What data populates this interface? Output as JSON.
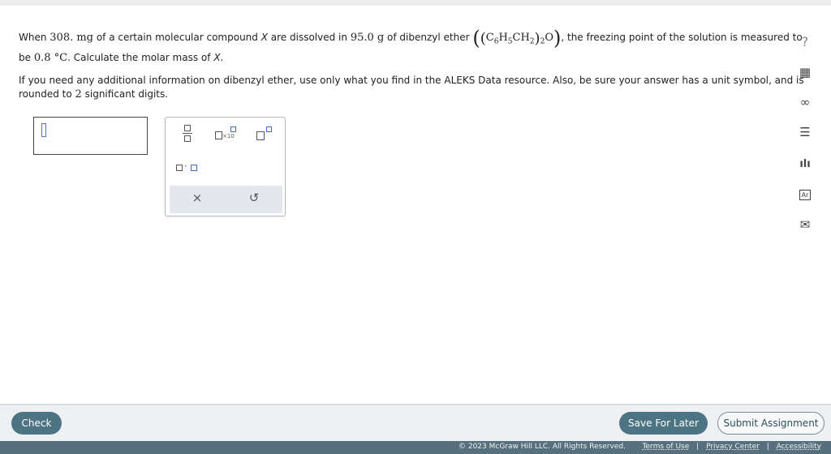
{
  "question": {
    "l1_a": "When ",
    "mass": "308. mg",
    "l1_b": " of a certain molecular compound ",
    "compound": "X",
    "l1_c": " are dissolved in ",
    "solvent_mass": "95.0 g",
    "l1_d": " of dibenzyl ether ",
    "formula": {
      "c": "C",
      "c_sub": "6",
      "h": "H",
      "h_sub": "5",
      "ch": "CH",
      "ch_sub": "2",
      "group_sub": "2",
      "o": "O"
    },
    "l1_e": ", the freezing point of the solution is measured to",
    "l2_a": "be ",
    "temp": "0.8 °C",
    "l2_b": ". Calculate the molar mass of ",
    "l2_c": ".",
    "l3": "If you need any additional information on dibenzyl ether, use only what you find in the ALEKS Data resource. Also, be sure your answer has a unit symbol, and is",
    "l4_a": "rounded to ",
    "sig_figs": "2",
    "l4_b": " significant digits."
  },
  "answer": {
    "value": ""
  },
  "palette": {
    "times_symbol": "×10",
    "dot_symbol": "·",
    "clear_symbol": "×",
    "undo_symbol": "↺"
  },
  "sidebar": {
    "help": "?",
    "calculator": "▦",
    "link": "∞",
    "notes": "☰",
    "chart": "ılı",
    "periodic": "Ar",
    "mail": "✉"
  },
  "footer": {
    "check": "Check",
    "save": "Save For Later",
    "submit": "Submit Assignment",
    "copyright": "© 2023 McGraw Hill LLC. All Rights Reserved.",
    "terms": "Terms of Use",
    "privacy": "Privacy Center",
    "accessibility": "Accessibility"
  }
}
